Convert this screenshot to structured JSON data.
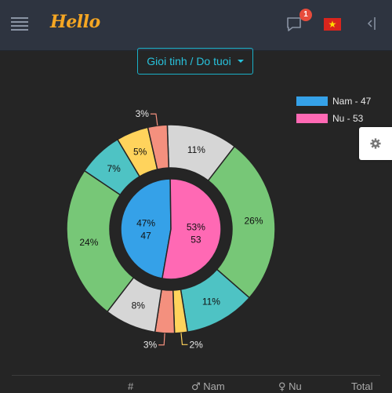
{
  "header": {
    "logo_text": "Hello",
    "notification_count": "1",
    "language_flag": "vietnam-flag"
  },
  "filter": {
    "label": "Gioi tinh / Do tuoi"
  },
  "legend": [
    {
      "label": "Nam - 47",
      "color": "#35a1e8"
    },
    {
      "label": "Nu - 53",
      "color": "#ff69b4"
    }
  ],
  "chart_data": {
    "type": "pie",
    "inner": [
      {
        "name": "Nam",
        "percent": 47,
        "value": 47,
        "color": "#35a1e8",
        "label": "47%",
        "sublabel": "47"
      },
      {
        "name": "Nu",
        "percent": 53,
        "value": 53,
        "color": "#ff69b4",
        "label": "53%",
        "sublabel": "53"
      }
    ],
    "outer": [
      {
        "percent": 11,
        "color": "#d6d6d6",
        "label": "11%"
      },
      {
        "percent": 26,
        "color": "#77c777",
        "label": "26%"
      },
      {
        "percent": 11,
        "color": "#4ec3c4",
        "label": "11%"
      },
      {
        "percent": 2,
        "color": "#ffd35c",
        "label": "2%"
      },
      {
        "percent": 3,
        "color": "#f4907e",
        "label": "3%"
      },
      {
        "percent": 8,
        "color": "#d6d6d6",
        "label": "8%"
      },
      {
        "percent": 24,
        "color": "#77c777",
        "label": "24%"
      },
      {
        "percent": 7,
        "color": "#4ec3c4",
        "label": "7%"
      },
      {
        "percent": 5,
        "color": "#ffd35c",
        "label": "5%"
      },
      {
        "percent": 3,
        "color": "#f4907e",
        "label": "3%"
      }
    ]
  },
  "table": {
    "headers": [
      "#",
      "Nam",
      "Nu",
      "Total"
    ],
    "icons": [
      "",
      "male-icon",
      "female-icon",
      ""
    ]
  }
}
